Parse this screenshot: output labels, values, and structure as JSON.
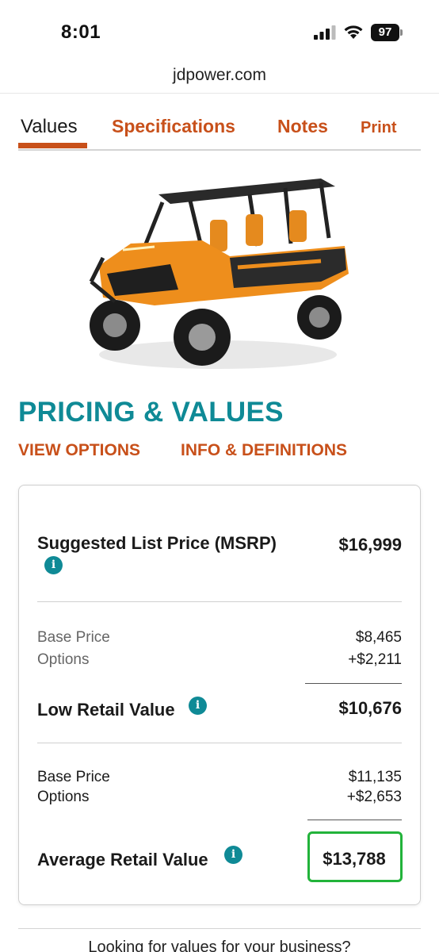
{
  "status_bar": {
    "time": "8:01",
    "battery": "97"
  },
  "browser": {
    "url": "jdpower.com"
  },
  "tabs": [
    {
      "label": "Values"
    },
    {
      "label": "Specifications"
    },
    {
      "label": "Notes"
    },
    {
      "label": "Print"
    }
  ],
  "pricing": {
    "title": "PRICING & VALUES",
    "view_options": "VIEW OPTIONS",
    "info_definitions": "INFO & DEFINITIONS"
  },
  "card": {
    "msrp": {
      "label": "Suggested List Price (MSRP)",
      "value": "$16,999"
    },
    "low": {
      "base_label": "Base Price",
      "base_value": "$8,465",
      "options_label": "Options",
      "options_value": "+$2,211",
      "label": "Low Retail Value",
      "value": "$10,676"
    },
    "average": {
      "base_label": "Base Price",
      "base_value": "$11,135",
      "options_label": "Options",
      "options_value": "+$2,653",
      "label": "Average Retail Value",
      "value": "$13,788"
    }
  },
  "footer": {
    "text": "Looking for values for your business?"
  },
  "colors": {
    "accent": "#c8501a",
    "teal": "#0f8a96",
    "highlight": "#22b33a"
  }
}
